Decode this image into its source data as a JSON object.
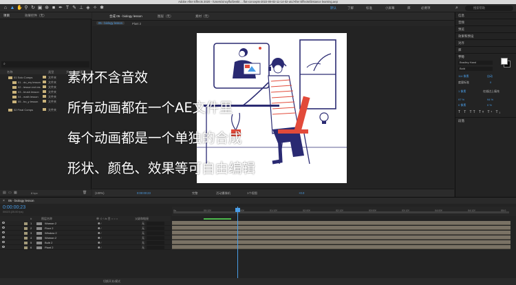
{
  "app": {
    "title": "Adobe After Effects 2020 - /Users/xinxylfu/Deskt ... flat-concepts-2022-09-02-11-14-02-utc/After Effects/Distance learning.aep"
  },
  "toolbar": {
    "workspaces": [
      "默认",
      "了解",
      "标准",
      "小屏幕",
      "库",
      "必要项"
    ],
    "active_workspace": "默认",
    "search_placeholder": "搜索帮助"
  },
  "project_panel": {
    "tabs": [
      "项目",
      "效果控件（无）"
    ],
    "columns": [
      "名称",
      "类型",
      "大小",
      "帧速率"
    ],
    "items": [
      {
        "name": "01 Solo Comps",
        "type": "文件夹"
      },
      {
        "name": "01 - do_ery lesson",
        "type": "文件夹"
      },
      {
        "name": "02 - lesson ext res",
        "type": "文件夹"
      },
      {
        "name": "03 - brush lesson",
        "type": "文件夹"
      },
      {
        "name": "04 - math lesson",
        "type": "文件夹"
      },
      {
        "name": "05 - bo_y lesson",
        "type": "文件夹"
      },
      {
        "name": "02 Final Comps",
        "type": "文件夹"
      }
    ],
    "footer_bpc": "8 bpc"
  },
  "comp_panel": {
    "tabs": [
      "合成 05 - biology lesson",
      "图层（无）",
      "素材（无）"
    ],
    "subtabs": [
      "05 - biology lesson",
      "Plant 2"
    ],
    "zoom": "(100%)",
    "timecode": "0:00:00:23",
    "resolution": "完整",
    "camera": "活动摄像机",
    "views": "1个视图",
    "exposure": "+0.0"
  },
  "right_panel": {
    "sections": [
      "信息",
      "音频",
      "预览",
      "效果和预设",
      "对齐",
      "库",
      "字符",
      "段落"
    ],
    "font": "Bradley Hand",
    "font_style": "Bold",
    "font_size": "114 像素",
    "leading": "自动",
    "kerning": "度量标准",
    "tracking": "0",
    "stroke": "1 像素",
    "stroke_mode": "在描边上填充",
    "vscale": "97 %",
    "hscale": "94 %",
    "baseline": "0 像素",
    "tsume": "0 %",
    "colors": {
      "fill": "#ffffff",
      "stroke": "#000000"
    }
  },
  "timeline": {
    "tab": "05 - biology lesson",
    "current_time": "0:00:00:23",
    "frames": "00023 (25.00 fps)",
    "columns": [
      "#",
      "图层名称",
      "单 ☆ \\ fx 目 ○ ○ ○",
      "父级和链接"
    ],
    "layers": [
      {
        "num": "1",
        "name": "Woman 2",
        "parent": "无"
      },
      {
        "num": "2",
        "name": "Floor 2",
        "parent": "无"
      },
      {
        "num": "3",
        "name": "Window 2",
        "parent": "无"
      },
      {
        "num": "4",
        "name": "Woman 2",
        "parent": "无"
      },
      {
        "num": "5",
        "name": "Bulb 2",
        "parent": "无"
      },
      {
        "num": "6",
        "name": "Plant 2",
        "parent": "无"
      }
    ],
    "ruler_ticks": [
      "0s",
      "00:12f",
      "01:00f",
      "01:12f",
      "02:00f",
      "02:12f",
      "03:00f",
      "03:12f",
      "04:00f",
      "04:12f",
      "05:0"
    ],
    "footer": "切换开关/模式"
  },
  "captions": [
    "素材不含音效",
    "所有动画都在一个AE文件里",
    "每个动画都是一个单独的合成",
    "形状、颜色、效果等可自由编辑"
  ]
}
